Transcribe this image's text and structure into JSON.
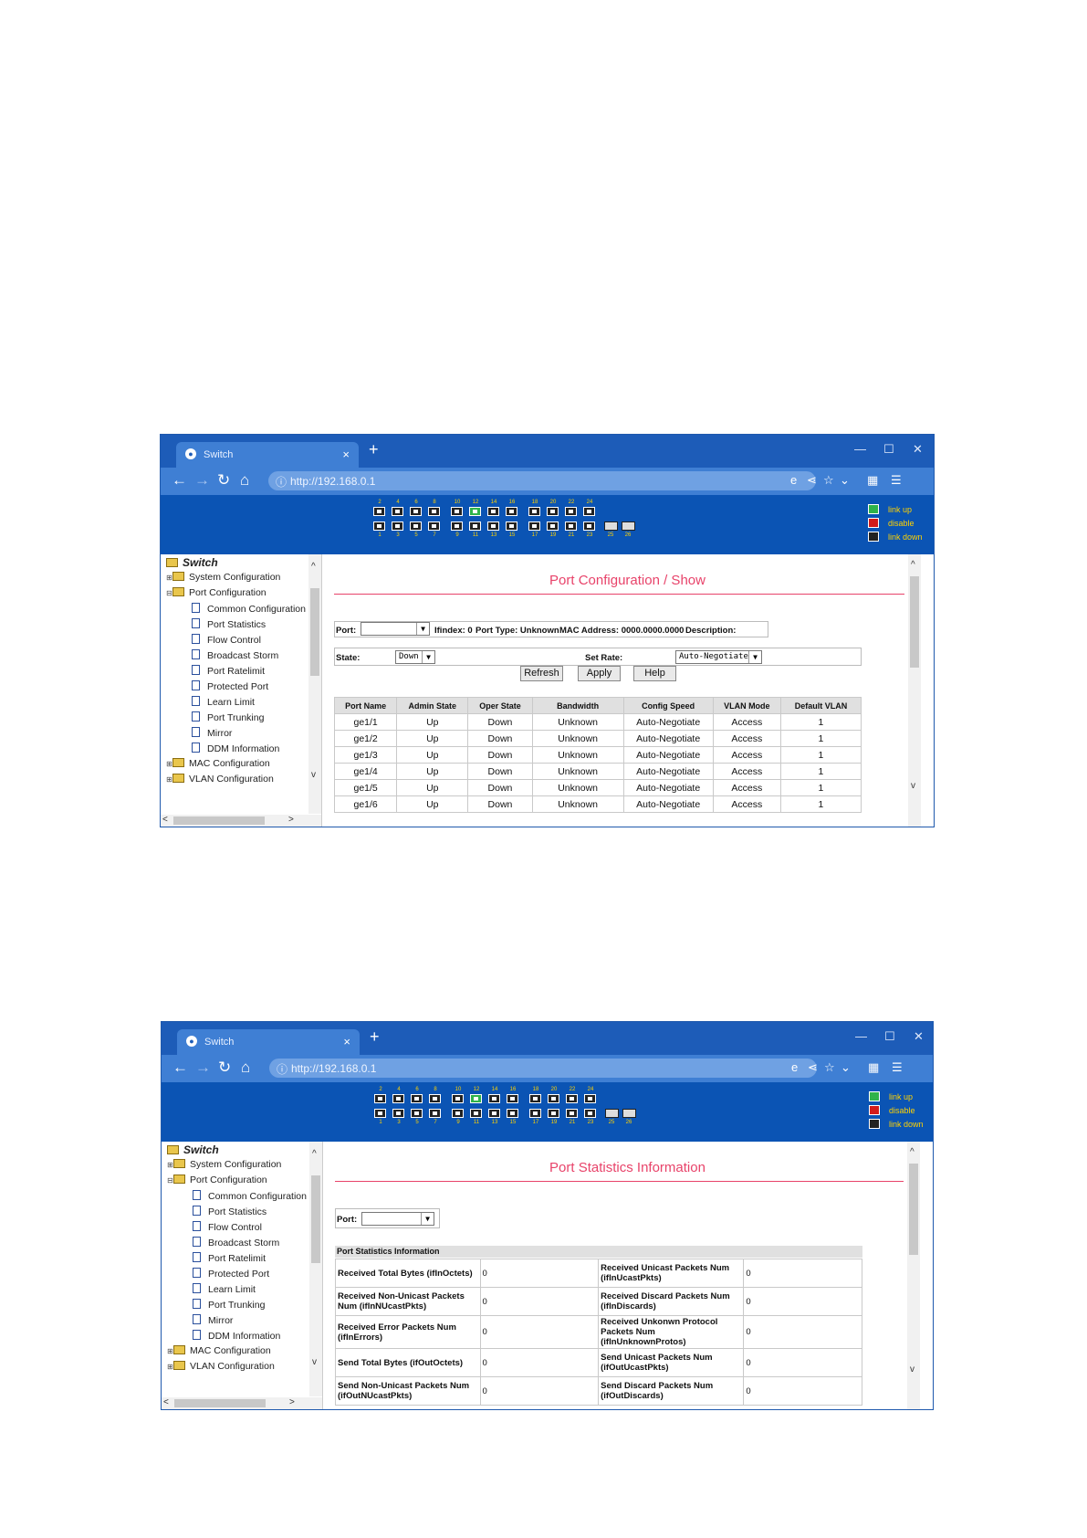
{
  "windows": [
    {
      "tab_title": "Switch",
      "url": "http://192.168.0.1",
      "legend": [
        "link up",
        "disable",
        "link down"
      ],
      "port_top_numbers": [
        "2",
        "4",
        "6",
        "8",
        "10",
        "12",
        "14",
        "16",
        "18",
        "20",
        "22",
        "24"
      ],
      "port_bottom_numbers": [
        "1",
        "3",
        "5",
        "7",
        "9",
        "11",
        "13",
        "15",
        "17",
        "19",
        "21",
        "23",
        "25",
        "26"
      ],
      "tree_root": "Switch",
      "tree": [
        "System Configuration",
        "Port Configuration",
        "Common Configuration",
        "Port Statistics",
        "Flow Control",
        "Broadcast Storm",
        "Port Ratelimit",
        "Protected Port",
        "Learn Limit",
        "Port Trunking",
        "Mirror",
        "DDM Information",
        "MAC Configuration",
        "VLAN Configuration"
      ],
      "page_title": "Port Configuration / Show",
      "port_label": "Port:",
      "ifindex": "Ifindex: 0",
      "port_type": "Port Type: Unknown",
      "mac": "MAC Address: 0000.0000.0000",
      "description": "Description:",
      "state_label": "State:",
      "state_value": "Down",
      "set_rate_label": "Set Rate:",
      "set_rate_value": "Auto-Negotiate",
      "buttons": [
        "Refresh",
        "Apply",
        "Help"
      ],
      "table_headers": [
        "Port Name",
        "Admin State",
        "Oper State",
        "Bandwidth",
        "Config Speed",
        "VLAN Mode",
        "Default VLAN"
      ],
      "rows": [
        [
          "ge1/1",
          "Up",
          "Down",
          "Unknown",
          "Auto-Negotiate",
          "Access",
          "1"
        ],
        [
          "ge1/2",
          "Up",
          "Down",
          "Unknown",
          "Auto-Negotiate",
          "Access",
          "1"
        ],
        [
          "ge1/3",
          "Up",
          "Down",
          "Unknown",
          "Auto-Negotiate",
          "Access",
          "1"
        ],
        [
          "ge1/4",
          "Up",
          "Down",
          "Unknown",
          "Auto-Negotiate",
          "Access",
          "1"
        ],
        [
          "ge1/5",
          "Up",
          "Down",
          "Unknown",
          "Auto-Negotiate",
          "Access",
          "1"
        ],
        [
          "ge1/6",
          "Up",
          "Down",
          "Unknown",
          "Auto-Negotiate",
          "Access",
          "1"
        ]
      ]
    },
    {
      "tab_title": "Switch",
      "url": "http://192.168.0.1",
      "legend": [
        "link up",
        "disable",
        "link down"
      ],
      "tree_root": "Switch",
      "page_title": "Port Statistics Information",
      "port_label": "Port:",
      "section_title": "Port Statistics Information",
      "stats": [
        [
          "Received Total Bytes (ifInOctets)",
          "0",
          "Received Unicast Packets Num (ifInUcastPkts)",
          "0"
        ],
        [
          "Received Non-Unicast Packets Num (ifInNUcastPkts)",
          "0",
          "Received Discard Packets Num (ifInDiscards)",
          "0"
        ],
        [
          "Received Error Packets Num (ifInErrors)",
          "0",
          "Received Unkonwn Protocol Packets Num (ifInUnknownProtos)",
          "0"
        ],
        [
          "Send Total Bytes (ifOutOctets)",
          "0",
          "Send Unicast Packets Num (ifOutUcastPkts)",
          "0"
        ],
        [
          "Send Non-Unicast Packets Num (ifOutNUcastPkts)",
          "0",
          "Send Discard Packets Num (ifOutDiscards)",
          "0"
        ]
      ]
    }
  ],
  "colors": {
    "titlebar": "#1d5cb8",
    "banner": "#0b54b4",
    "accent": "#e8436a",
    "link_up": "#2fb34a",
    "disable": "#d21b1b"
  }
}
